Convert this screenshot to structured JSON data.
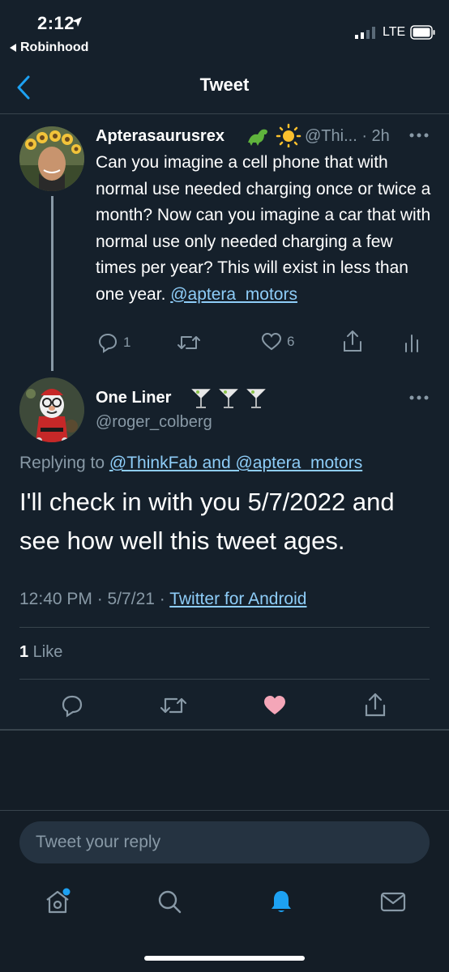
{
  "status_bar": {
    "time": "2:12",
    "back_app": "Robinhood",
    "carrier": "LTE"
  },
  "header": {
    "title": "Tweet"
  },
  "parent_tweet": {
    "name": "Apterasaurusrex",
    "handle": "@Thi... · 2h",
    "text": "Can you imagine a cell phone that with normal use needed charging once or twice a month? Now can you imagine a car that with normal use only needed charging a few times per year? This will exist in less than one year. ",
    "mention": "@aptera_motors",
    "reply_count": "1",
    "like_count": "6"
  },
  "main_tweet": {
    "name": "One Liner",
    "handle": "@roger_colberg",
    "replying_prefix": "Replying to ",
    "replying_mentions": "@ThinkFab and @aptera_motors",
    "text": "I'll check in with you 5/7/2022 and see how well this tweet ages.",
    "timestamp": "12:40 PM · 5/7/21 · ",
    "source": "Twitter for Android",
    "likes_count": "1",
    "likes_label": " Like"
  },
  "reply_box": {
    "placeholder": "Tweet your reply"
  },
  "colors": {
    "background": "#15202b",
    "accent_blue": "#1da1f2",
    "like_pink": "#f4a6b8",
    "muted": "#8899a6"
  },
  "icons": {
    "tabs": [
      "home-icon",
      "search-icon",
      "bell-icon",
      "mail-icon"
    ]
  }
}
